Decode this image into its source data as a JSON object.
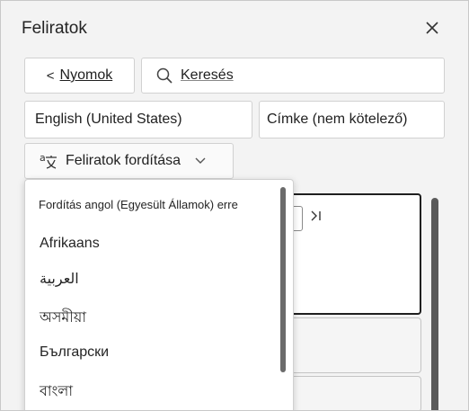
{
  "panel": {
    "title": "Feliratok"
  },
  "toolbar": {
    "back_label": "Nyomok",
    "back_chevron": "<",
    "search_placeholder": "Keresés"
  },
  "fields": {
    "language_value": "English (United States)",
    "tag_placeholder": "Címke (nem kötelező)"
  },
  "translate": {
    "label": "Feliratok fordítása"
  },
  "dropdown": {
    "header": "Fordítás angol (Egyesült Államok) erre",
    "items": [
      {
        "label": "Afrikaans"
      },
      {
        "label": "العربية"
      },
      {
        "label": "অসমীয়া"
      },
      {
        "label": "Български"
      },
      {
        "label": "বাংলা"
      }
    ]
  },
  "icons": {
    "close": "close-icon",
    "search": "search-icon",
    "translate": "translate-icon",
    "chevron": "chevron-down-icon",
    "skip": "skip-to-end-icon"
  },
  "colors": {
    "panel_bg": "#f3f3f3",
    "border": "#d1d1d1",
    "text": "#242424",
    "scrollbar": "#6b6b6b"
  }
}
